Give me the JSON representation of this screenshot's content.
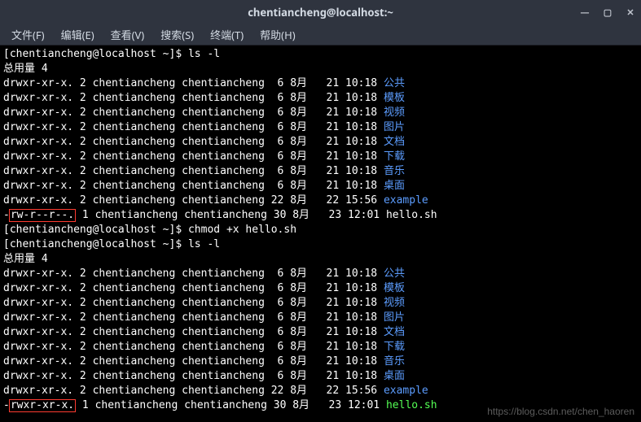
{
  "window": {
    "title": "chentiancheng@localhost:~"
  },
  "menu": {
    "file": "文件(F)",
    "edit": "编辑(E)",
    "view": "查看(V)",
    "search": "搜索(S)",
    "terminal": "终端(T)",
    "help": "帮助(H)"
  },
  "prompt": {
    "text": "[chentiancheng@localhost ~]$ "
  },
  "commands": {
    "ls1": "ls -l",
    "chmod": "chmod +x hello.sh",
    "ls2": "ls -l"
  },
  "total_label": "总用量 4",
  "listing1": [
    {
      "perm": "drwxr-xr-x.",
      "links": "2",
      "owner": "chentiancheng",
      "group": "chentiancheng",
      "size": " 6",
      "month": "8月",
      "day": "21",
      "time": "10:18",
      "name": "公共",
      "cls": "dir"
    },
    {
      "perm": "drwxr-xr-x.",
      "links": "2",
      "owner": "chentiancheng",
      "group": "chentiancheng",
      "size": " 6",
      "month": "8月",
      "day": "21",
      "time": "10:18",
      "name": "模板",
      "cls": "dir"
    },
    {
      "perm": "drwxr-xr-x.",
      "links": "2",
      "owner": "chentiancheng",
      "group": "chentiancheng",
      "size": " 6",
      "month": "8月",
      "day": "21",
      "time": "10:18",
      "name": "视频",
      "cls": "dir"
    },
    {
      "perm": "drwxr-xr-x.",
      "links": "2",
      "owner": "chentiancheng",
      "group": "chentiancheng",
      "size": " 6",
      "month": "8月",
      "day": "21",
      "time": "10:18",
      "name": "图片",
      "cls": "dir"
    },
    {
      "perm": "drwxr-xr-x.",
      "links": "2",
      "owner": "chentiancheng",
      "group": "chentiancheng",
      "size": " 6",
      "month": "8月",
      "day": "21",
      "time": "10:18",
      "name": "文档",
      "cls": "dir"
    },
    {
      "perm": "drwxr-xr-x.",
      "links": "2",
      "owner": "chentiancheng",
      "group": "chentiancheng",
      "size": " 6",
      "month": "8月",
      "day": "21",
      "time": "10:18",
      "name": "下载",
      "cls": "dir"
    },
    {
      "perm": "drwxr-xr-x.",
      "links": "2",
      "owner": "chentiancheng",
      "group": "chentiancheng",
      "size": " 6",
      "month": "8月",
      "day": "21",
      "time": "10:18",
      "name": "音乐",
      "cls": "dir"
    },
    {
      "perm": "drwxr-xr-x.",
      "links": "2",
      "owner": "chentiancheng",
      "group": "chentiancheng",
      "size": " 6",
      "month": "8月",
      "day": "21",
      "time": "10:18",
      "name": "桌面",
      "cls": "dir"
    },
    {
      "perm": "drwxr-xr-x.",
      "links": "2",
      "owner": "chentiancheng",
      "group": "chentiancheng",
      "size": "22",
      "month": "8月",
      "day": "22",
      "time": "15:56",
      "name": "example",
      "cls": "dir"
    },
    {
      "perm": "-rw-r--r--.",
      "links": "1",
      "owner": "chentiancheng",
      "group": "chentiancheng",
      "size": "30",
      "month": "8月",
      "day": "23",
      "time": "12:01",
      "name": "hello.sh",
      "cls": "text-file",
      "hl": true
    }
  ],
  "listing2": [
    {
      "perm": "drwxr-xr-x.",
      "links": "2",
      "owner": "chentiancheng",
      "group": "chentiancheng",
      "size": " 6",
      "month": "8月",
      "day": "21",
      "time": "10:18",
      "name": "公共",
      "cls": "dir"
    },
    {
      "perm": "drwxr-xr-x.",
      "links": "2",
      "owner": "chentiancheng",
      "group": "chentiancheng",
      "size": " 6",
      "month": "8月",
      "day": "21",
      "time": "10:18",
      "name": "模板",
      "cls": "dir"
    },
    {
      "perm": "drwxr-xr-x.",
      "links": "2",
      "owner": "chentiancheng",
      "group": "chentiancheng",
      "size": " 6",
      "month": "8月",
      "day": "21",
      "time": "10:18",
      "name": "视频",
      "cls": "dir"
    },
    {
      "perm": "drwxr-xr-x.",
      "links": "2",
      "owner": "chentiancheng",
      "group": "chentiancheng",
      "size": " 6",
      "month": "8月",
      "day": "21",
      "time": "10:18",
      "name": "图片",
      "cls": "dir"
    },
    {
      "perm": "drwxr-xr-x.",
      "links": "2",
      "owner": "chentiancheng",
      "group": "chentiancheng",
      "size": " 6",
      "month": "8月",
      "day": "21",
      "time": "10:18",
      "name": "文档",
      "cls": "dir"
    },
    {
      "perm": "drwxr-xr-x.",
      "links": "2",
      "owner": "chentiancheng",
      "group": "chentiancheng",
      "size": " 6",
      "month": "8月",
      "day": "21",
      "time": "10:18",
      "name": "下载",
      "cls": "dir"
    },
    {
      "perm": "drwxr-xr-x.",
      "links": "2",
      "owner": "chentiancheng",
      "group": "chentiancheng",
      "size": " 6",
      "month": "8月",
      "day": "21",
      "time": "10:18",
      "name": "音乐",
      "cls": "dir"
    },
    {
      "perm": "drwxr-xr-x.",
      "links": "2",
      "owner": "chentiancheng",
      "group": "chentiancheng",
      "size": " 6",
      "month": "8月",
      "day": "21",
      "time": "10:18",
      "name": "桌面",
      "cls": "dir"
    },
    {
      "perm": "drwxr-xr-x.",
      "links": "2",
      "owner": "chentiancheng",
      "group": "chentiancheng",
      "size": "22",
      "month": "8月",
      "day": "22",
      "time": "15:56",
      "name": "example",
      "cls": "dir"
    },
    {
      "perm": "-rwxr-xr-x.",
      "links": "1",
      "owner": "chentiancheng",
      "group": "chentiancheng",
      "size": "30",
      "month": "8月",
      "day": "23",
      "time": "12:01",
      "name": "hello.sh",
      "cls": "exec",
      "hl": true
    }
  ],
  "watermark": "https://blog.csdn.net/chen_haoren"
}
